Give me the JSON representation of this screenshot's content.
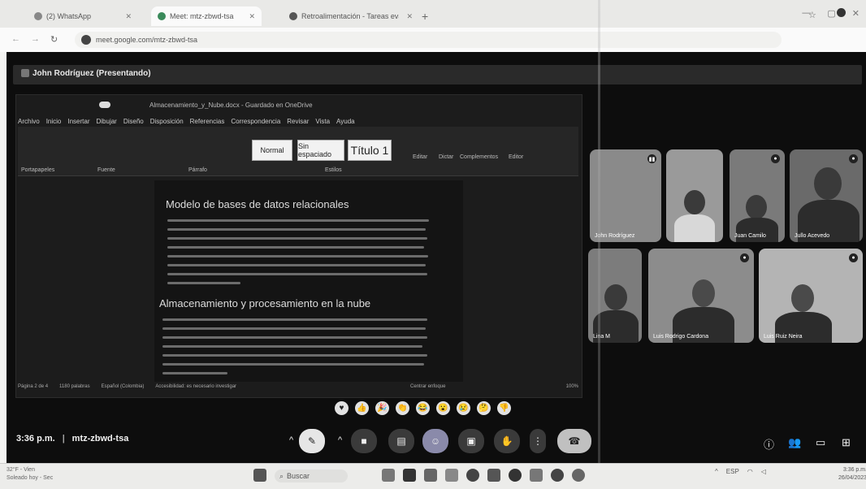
{
  "browser": {
    "tabs": [
      {
        "label": "(2) WhatsApp",
        "active": false
      },
      {
        "label": "Meet: mtz-zbwd-tsa",
        "active": true
      },
      {
        "label": "Retroalimentación - Tareas evaluativas",
        "active": false
      }
    ],
    "new_tab": "+",
    "url": "meet.google.com/mtz-zbwd-tsa",
    "window_controls": [
      "—",
      "▢",
      "✕"
    ]
  },
  "meet": {
    "presenter": "John Rodríguez (Presentando)",
    "word": {
      "title": "Almacenamiento_y_Nube.docx - Guardado en OneDrive",
      "menu": [
        "Archivo",
        "Inicio",
        "Insertar",
        "Dibujar",
        "Diseño",
        "Disposición",
        "Referencias",
        "Correspondencia",
        "Revisar",
        "Vista",
        "Ayuda"
      ],
      "styles": [
        "Normal",
        "Sin espaciado",
        "Título 1"
      ],
      "ribbon_groups": [
        "Portapapeles",
        "Fuente",
        "Párrafo",
        "Estilos",
        "Editar",
        "Dictar",
        "Complementos",
        "Editor"
      ],
      "heading1": "Modelo de bases de datos relacionales",
      "heading2": "Almacenamiento y procesamiento en la nube",
      "status": [
        "Página 2 de 4",
        "1180 palabras",
        "Español (Colombia)",
        "Accesibilidad: es necesario investigar",
        "Centrar enfoque",
        "100%"
      ]
    },
    "participants": [
      {
        "name": "John Rodríguez"
      },
      {
        "name": ""
      },
      {
        "name": "Juan Camilo"
      },
      {
        "name": "Jullo Acevedo"
      },
      {
        "name": "Lina M"
      },
      {
        "name": "Luis Rodrigo Cardona"
      },
      {
        "name": "Luis Ruiz Neira"
      }
    ],
    "reactions": [
      "♥",
      "👍",
      "🎉",
      "👏",
      "😂",
      "😮",
      "😢",
      "🤔",
      "👎"
    ],
    "time": "3:36 p.m.",
    "meeting_code": "mtz-zbwd-tsa",
    "separator": "|"
  },
  "taskbar": {
    "weather_line1": "32°F - Vien",
    "weather_line2": "Soleado hoy - Sec",
    "search_placeholder": "Buscar",
    "clock_time": "3:36 p.m.",
    "clock_date": "26/04/2023",
    "lang": "ESP"
  }
}
